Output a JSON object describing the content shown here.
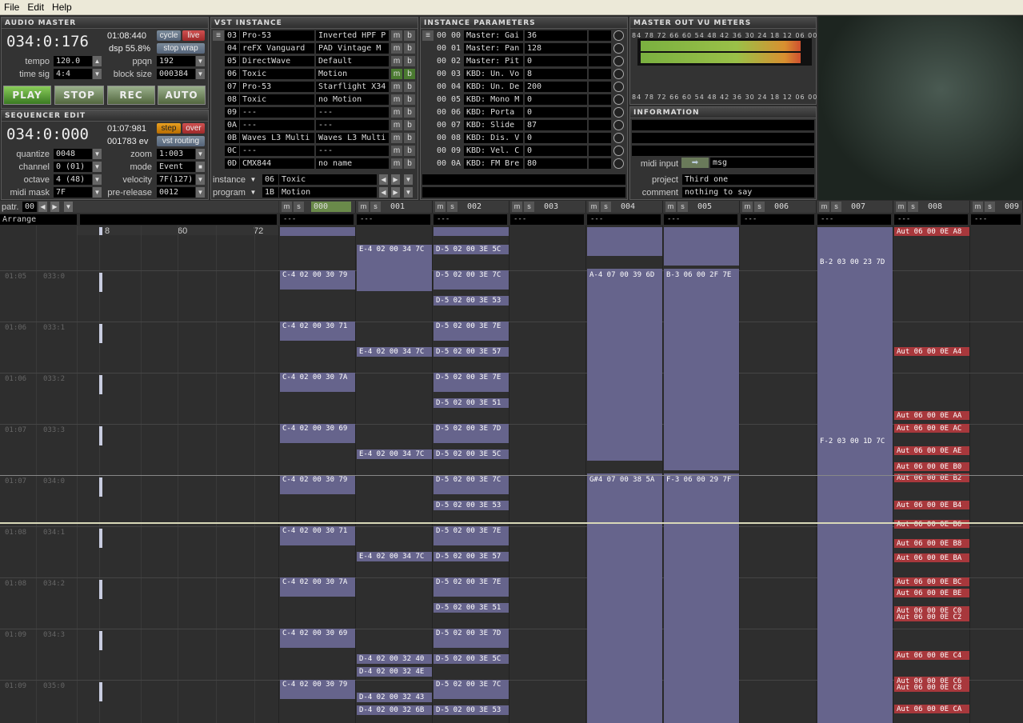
{
  "menu": [
    "File",
    "Edit",
    "Help"
  ],
  "audio_master": {
    "title": "AUDIO MASTER",
    "time": "034:0:176",
    "clock": "01:08:440",
    "cycle": "cycle",
    "live": "live",
    "dsp": "dsp 55.8%",
    "stop_wrap": "stop wrap",
    "tempo_label": "tempo",
    "tempo": "120.0",
    "ppqn_label": "ppqn",
    "ppqn": "192",
    "timesig_label": "time sig",
    "timesig": "4:4",
    "block_label": "block size",
    "block": "000384"
  },
  "transport": {
    "play": "PLAY",
    "stop": "STOP",
    "rec": "REC",
    "auto": "AUTO"
  },
  "seq_edit": {
    "title": "SEQUENCER EDIT",
    "time": "034:0:000",
    "clock": "01:07:981",
    "step": "step",
    "over": "over",
    "events": "001783 ev",
    "vst_routing": "vst routing",
    "quantize_label": "quantize",
    "quantize": "0048",
    "zoom_label": "zoom",
    "zoom": "1:003",
    "channel_label": "channel",
    "channel": "0 (01)",
    "mode_label": "mode",
    "mode": "Event",
    "octave_label": "octave",
    "octave": "4 (48)",
    "velocity_label": "velocity",
    "velocity": "7F(127)",
    "midimask_label": "midi mask",
    "midimask": "7F",
    "prerelease_label": "pre-release",
    "prerelease": "0012"
  },
  "vst": {
    "title": "VST INSTANCE",
    "rows": [
      {
        "id": "03",
        "name": "Pro-53",
        "preset": "Inverted HPF P"
      },
      {
        "id": "04",
        "name": "reFX Vanguard",
        "preset": "PAD Vintage  M"
      },
      {
        "id": "05",
        "name": "DirectWave",
        "preset": "Default"
      },
      {
        "id": "06",
        "name": "Toxic",
        "preset": "Motion"
      },
      {
        "id": "07",
        "name": "Pro-53",
        "preset": "Starflight X34"
      },
      {
        "id": "08",
        "name": "Toxic",
        "preset": "no Motion"
      },
      {
        "id": "09",
        "name": "---",
        "preset": "---"
      },
      {
        "id": "0A",
        "name": "---",
        "preset": "---"
      },
      {
        "id": "0B",
        "name": "Waves L3 Multi",
        "preset": "Waves L3 Multi"
      },
      {
        "id": "0C",
        "name": "---",
        "preset": "---"
      },
      {
        "id": "0D",
        "name": "CMX844",
        "preset": "no name"
      }
    ],
    "m": "m",
    "b": "b",
    "instance_label": "instance",
    "instance_id": "06",
    "instance_name": "Toxic",
    "program_label": "program",
    "program_id": "1B",
    "program_name": "Motion"
  },
  "params": {
    "title": "INSTANCE PARAMETERS",
    "rows": [
      {
        "a": "00",
        "b": "00",
        "name": "Master: Gai",
        "val": "36"
      },
      {
        "a": "00",
        "b": "01",
        "name": "Master: Pan",
        "val": "128"
      },
      {
        "a": "00",
        "b": "02",
        "name": "Master: Pit",
        "val": "0"
      },
      {
        "a": "00",
        "b": "03",
        "name": "KBD: Un. Vo",
        "val": "8"
      },
      {
        "a": "00",
        "b": "04",
        "name": "KBD: Un. De",
        "val": "200"
      },
      {
        "a": "00",
        "b": "05",
        "name": "KBD: Mono M",
        "val": "0"
      },
      {
        "a": "00",
        "b": "06",
        "name": "KBD: Porta",
        "val": "0"
      },
      {
        "a": "00",
        "b": "07",
        "name": "KBD: Slide",
        "val": "87"
      },
      {
        "a": "00",
        "b": "08",
        "name": "KBD: Dis. V",
        "val": "0"
      },
      {
        "a": "00",
        "b": "09",
        "name": "KBD: Vel. C",
        "val": "0"
      },
      {
        "a": "00",
        "b": "0A",
        "name": "KBD: FM Bre",
        "val": "80"
      }
    ]
  },
  "vu": {
    "title": "MASTER OUT VU METERS",
    "ticks": "84 78 72 66 60 54 48 42 36 30 24 18 12 06 00",
    "level_left": 0.96,
    "level_right": 0.96
  },
  "info": {
    "title": "INFORMATION",
    "midi_input": "midi input",
    "msg": "msg",
    "project_label": "project",
    "project": "Third one",
    "comment_label": "comment",
    "comment": "nothing to say"
  },
  "pattern": {
    "label": "patr.",
    "value": "00",
    "arrange": "Arrange",
    "ruler": [
      "8",
      "60",
      "72"
    ],
    "dash": "---"
  },
  "tracks": [
    {
      "n": "000",
      "m": "m",
      "s": "s"
    },
    {
      "n": "001",
      "m": "m",
      "s": "s"
    },
    {
      "n": "002",
      "m": "m",
      "s": "s"
    },
    {
      "n": "003",
      "m": "m",
      "s": "s"
    },
    {
      "n": "004",
      "m": "m",
      "s": "s"
    },
    {
      "n": "005",
      "m": "m",
      "s": "s"
    },
    {
      "n": "006",
      "m": "m",
      "s": "s"
    },
    {
      "n": "007",
      "m": "m",
      "s": "s"
    },
    {
      "n": "008",
      "m": "m",
      "s": "s"
    },
    {
      "n": "009",
      "m": "m",
      "s": "s"
    }
  ],
  "rows": [
    {
      "t": "01:05",
      "p": "033:0"
    },
    {
      "t": "01:06",
      "p": "033:1"
    },
    {
      "t": "01:06",
      "p": "033:2"
    },
    {
      "t": "01:07",
      "p": "033:3"
    },
    {
      "t": "01:07",
      "p": "034:0"
    },
    {
      "t": "01:08",
      "p": "034:1"
    },
    {
      "t": "01:08",
      "p": "034:2"
    },
    {
      "t": "01:09",
      "p": "034:3"
    },
    {
      "t": "01:09",
      "p": "035:0"
    }
  ],
  "events": {
    "c000": [
      "C-4 02 00 30 79",
      "C-4 02 00 30 71",
      "C-4 02 00 30 7A",
      "C-4 02 00 30 69",
      "C-4 02 00 30 79",
      "C-4 02 00 30 71",
      "C-4 02 00 30 7A",
      "C-4 02 00 30 69",
      "C-4 02 00 30 79"
    ],
    "c001": [
      "E-4 02 00 34 7C",
      "E-4 02 00 34 7C",
      "E-4 02 00 34 7C",
      "E-4 02 00 34 7C",
      "D-4 02 00 32 40",
      "D-4 02 00 32 4E",
      "D-4 02 00 32 43",
      "D-4 02 00 32 6B"
    ],
    "c002": [
      "D-5 02 00 3E 5C",
      "D-5 02 00 3E 7C",
      "D-5 02 00 3E 53",
      "D-5 02 00 3E 7E",
      "D-5 02 00 3E 57",
      "D-5 02 00 3E 7E",
      "D-5 02 00 3E 51",
      "D-5 02 00 3E 7D",
      "D-5 02 00 3E 5C",
      "D-5 02 00 3E 7C",
      "D-5 02 00 3E 53",
      "D-5 02 00 3E 7E",
      "D-5 02 00 3E 57",
      "D-5 02 00 3E 7E",
      "D-5 02 00 3E 51",
      "D-5 02 00 3E 7D",
      "D-5 02 00 3E 5C",
      "D-5 02 00 3E 7C",
      "D-5 02 00 3E 53"
    ],
    "c004": [
      "A-4 07 00 39 6D",
      "G#4 07 00 38 5A"
    ],
    "c005": [
      "B-3 06 00 2F 7E",
      "F-3 06 00 29 7F"
    ],
    "c007": [
      "B-2 03 00 23 7D",
      "F-2 03 00 1D 7C"
    ],
    "c008": [
      "Aut 06 00 0E A8",
      "Aut 06 00 0E A4",
      "Aut 06 00 0E AA",
      "Aut 06 00 0E AC",
      "Aut 06 00 0E AE",
      "Aut 06 00 0E B0",
      "Aut 06 00 0E B2",
      "Aut 06 00 0E B4",
      "Aut 06 00 0E B6",
      "Aut 06 00 0E B8",
      "Aut 06 00 0E BA",
      "Aut 06 00 0E BC",
      "Aut 06 00 0E BE",
      "Aut 06 00 0E C0",
      "Aut 06 00 0E C2",
      "Aut 06 00 0E C4",
      "Aut 06 00 0E C6",
      "Aut 06 00 0E C8",
      "Aut 06 00 0E CA"
    ]
  }
}
